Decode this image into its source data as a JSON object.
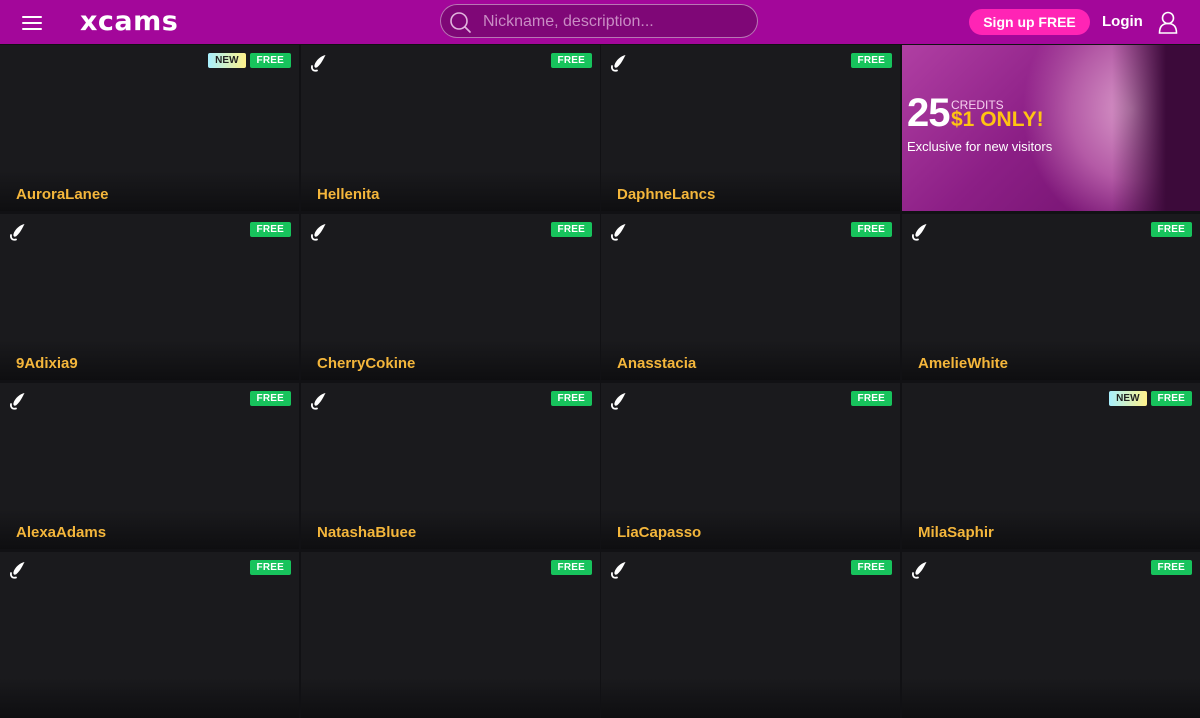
{
  "header": {
    "logo": "xcams",
    "search_placeholder": "Nickname, description...",
    "signup_label": "Sign up FREE",
    "login_label": "Login"
  },
  "badges": {
    "free": "FREE",
    "new": "NEW"
  },
  "promo": {
    "amount": "25",
    "credits_label": "CREDITS",
    "price": "$1 ONLY!",
    "subtitle": "Exclusive for new visitors"
  },
  "tiles": [
    {
      "name": "AuroraLanee",
      "new": true,
      "free": true,
      "icon": false
    },
    {
      "name": "Hellenita",
      "new": false,
      "free": true,
      "icon": true
    },
    {
      "name": "DaphneLancs",
      "new": false,
      "free": true,
      "icon": true
    },
    {
      "name": "9Adixia9",
      "new": false,
      "free": true,
      "icon": true
    },
    {
      "name": "CherryCokine",
      "new": false,
      "free": true,
      "icon": true
    },
    {
      "name": "Anasstacia",
      "new": false,
      "free": true,
      "icon": true
    },
    {
      "name": "AmelieWhite",
      "new": false,
      "free": true,
      "icon": true
    },
    {
      "name": "AlexaAdams",
      "new": false,
      "free": true,
      "icon": true
    },
    {
      "name": "NatashaBluee",
      "new": false,
      "free": true,
      "icon": true
    },
    {
      "name": "LiaCapasso",
      "new": false,
      "free": true,
      "icon": true
    },
    {
      "name": "MilaSaphir",
      "new": true,
      "free": true,
      "icon": false
    },
    {
      "name": "",
      "new": false,
      "free": true,
      "icon": true
    },
    {
      "name": "",
      "new": false,
      "free": true,
      "icon": false
    },
    {
      "name": "",
      "new": false,
      "free": true,
      "icon": true
    },
    {
      "name": "",
      "new": false,
      "free": true,
      "icon": true
    }
  ],
  "colors": {
    "header_bg": "#a3079a",
    "signup_bg": "#ff24b5",
    "badge_free": "#17c35c",
    "name_color": "#f4b63b",
    "tile_bg": "#1a1a1d"
  }
}
